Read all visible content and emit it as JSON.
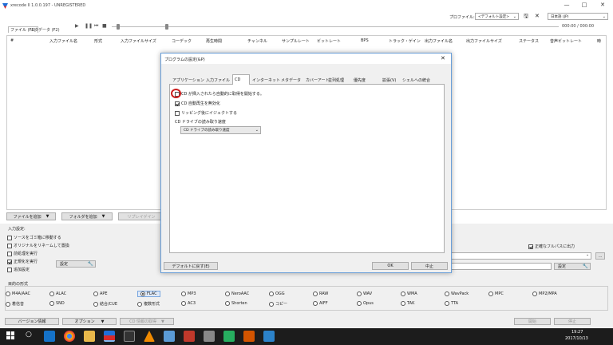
{
  "window": {
    "title": "xrecode II 1.0.0.197 - UNREGISTERED",
    "profile_label": "プロファイル:",
    "profile_value": "<デフォルト設定>",
    "language_value": "日本語 (JP)",
    "time_display": "000:00 / 000:00"
  },
  "tabs": [
    "ファイル (F1)",
    "メタデータ (F2)"
  ],
  "columns": [
    "#",
    "入力ファイル名",
    "形式",
    "入力ファイルサイズ",
    "コーデック",
    "再生時間",
    "チャンネル",
    "サンプルレート",
    "ビットレート",
    "BPS",
    "トラック・ゲイン",
    "出力ファイル名",
    "出力ファイルサイズ",
    "ステータス",
    "音声ビットレート",
    "時"
  ],
  "buttons": {
    "add_file": "ファイルを追加",
    "add_folder": "フォルダを追加",
    "replaygain": "リプレイゲイン",
    "settings_1": "設定",
    "settings_2": "設定",
    "version_info": "バージョン情報",
    "options": "オプション",
    "cd_get": "CD 情報の取得",
    "start": "開始",
    "stop": "停止",
    "browse": "..."
  },
  "input_settings": {
    "title": "入力設定:",
    "options": [
      {
        "label": "ソースをゴミ箱に移動する",
        "checked": false
      },
      {
        "label": "オリジナルをリネームして置換",
        "checked": false
      },
      {
        "label": "前処理を実行",
        "checked": false
      },
      {
        "label": "正規化を実行",
        "checked": true
      },
      {
        "label": "追加設定",
        "checked": false
      }
    ],
    "prefix_option": "追加設定"
  },
  "right_option": {
    "label": "正確なフルパスに出力",
    "checked": true
  },
  "format_title": "目的の形式",
  "formats": [
    [
      {
        "label": "M4A/AAC",
        "on": false
      },
      {
        "label": "ALAC",
        "on": false
      },
      {
        "label": "APE",
        "on": false
      },
      {
        "label": "FLAC",
        "on": true
      },
      {
        "label": "MP3",
        "on": false
      },
      {
        "label": "NeroAAC",
        "on": false
      },
      {
        "label": "OGG",
        "on": false
      },
      {
        "label": "RAW",
        "on": false
      },
      {
        "label": "WAV",
        "on": false
      },
      {
        "label": "WMA",
        "on": false
      },
      {
        "label": "WavPack",
        "on": false
      },
      {
        "label": "MPC",
        "on": false
      },
      {
        "label": "MP2/MPA",
        "on": false
      }
    ],
    [
      {
        "label": "着信音",
        "on": false
      },
      {
        "label": "SND",
        "on": false
      },
      {
        "label": "結合/CUE",
        "on": false
      },
      {
        "label": "複数形式",
        "on": false
      },
      {
        "label": "AC3",
        "on": false
      },
      {
        "label": "Shorten",
        "on": false
      },
      {
        "label": "コピー",
        "on": false
      },
      {
        "label": "AIFF",
        "on": false
      },
      {
        "label": "Opus",
        "on": false
      },
      {
        "label": "TAK",
        "on": false
      },
      {
        "label": "TTA",
        "on": false
      }
    ]
  ],
  "dialog": {
    "title": "プログラムの設定(&P)",
    "tabs": [
      "アプリケーション",
      "入力ファイル",
      "CD",
      "インターネット",
      "メタデータ",
      "カバーアート",
      "並列処理",
      "優先度",
      "拡張(V)",
      "シェルへの統合"
    ],
    "options": [
      {
        "label": "CD が挿入されたら自動的に取得を開始する。",
        "checked": false
      },
      {
        "label": "CD 自動再生を無効化",
        "checked": true
      },
      {
        "label": "リッピング後にイジェクトする",
        "checked": false
      }
    ],
    "speed_label": "CD ドライブの読み取り速度",
    "speed_value": "CD ドライブの読み取り速度",
    "default_button": "デフォルトに戻す(E)",
    "ok": "OK",
    "cancel": "中止"
  },
  "taskbar": {
    "time": "19:27",
    "date": "2017/10/13"
  },
  "colors": {
    "accent": "#0078d7",
    "highlight_circle": "#cc1f1f",
    "taskbar": "#1c1c1c",
    "panel": "#f0f0f0"
  }
}
